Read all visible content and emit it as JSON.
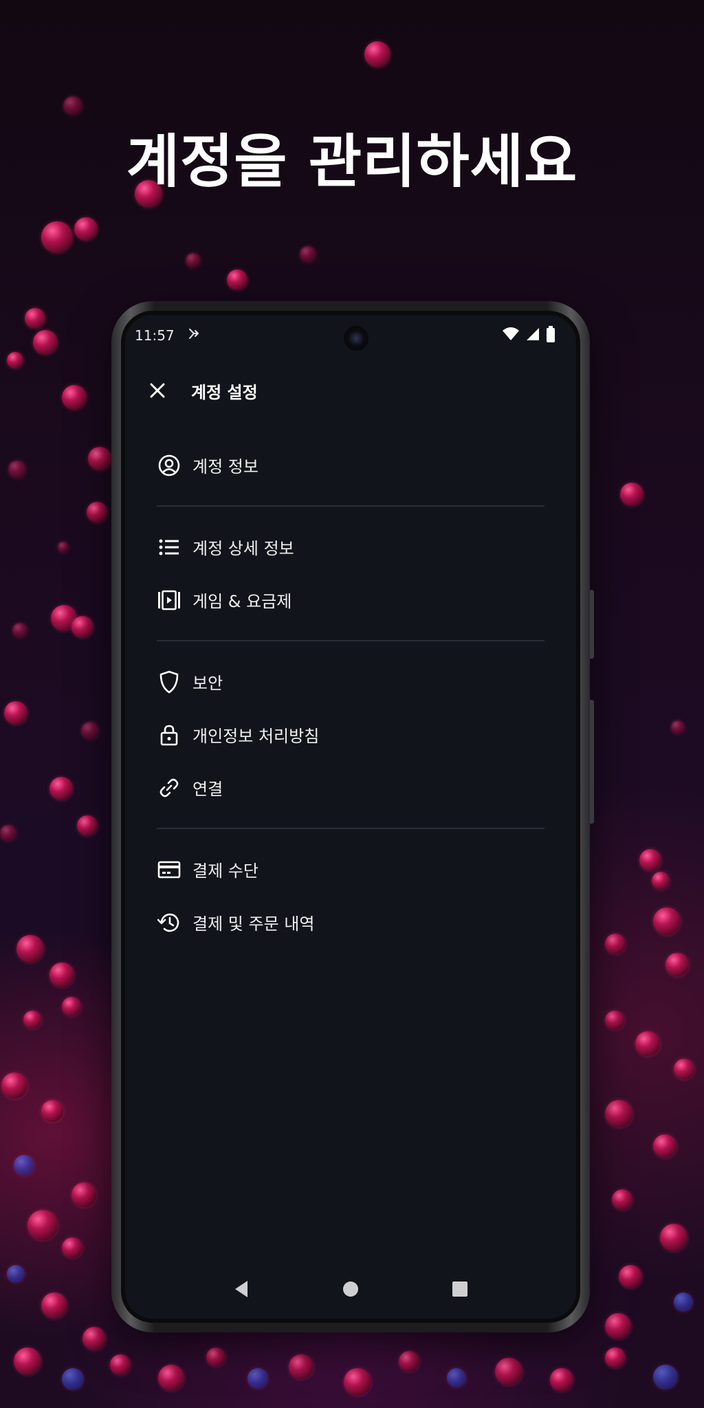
{
  "headline": "계정을 관리하세요",
  "status_bar": {
    "time": "11:57",
    "notification_icon": "assistant-icon",
    "wifi_icon": "wifi-icon",
    "signal_icon": "signal-icon",
    "battery_icon": "battery-icon"
  },
  "app_bar": {
    "title": "계정 설정",
    "close_icon": "close-icon"
  },
  "menu": {
    "account_info": "계정 정보",
    "account_details": "계정 상세 정보",
    "games_plans": "게임 & 요금제",
    "security": "보안",
    "privacy_policy": "개인정보 처리방침",
    "connections": "연결",
    "payment_methods": "결제 수단",
    "payment_history": "결제 및 주문 내역"
  },
  "colors": {
    "screen_bg": "#12141b",
    "divider": "#2a2d36",
    "text": "#f0f0f2",
    "bubble": "#b3134f"
  }
}
